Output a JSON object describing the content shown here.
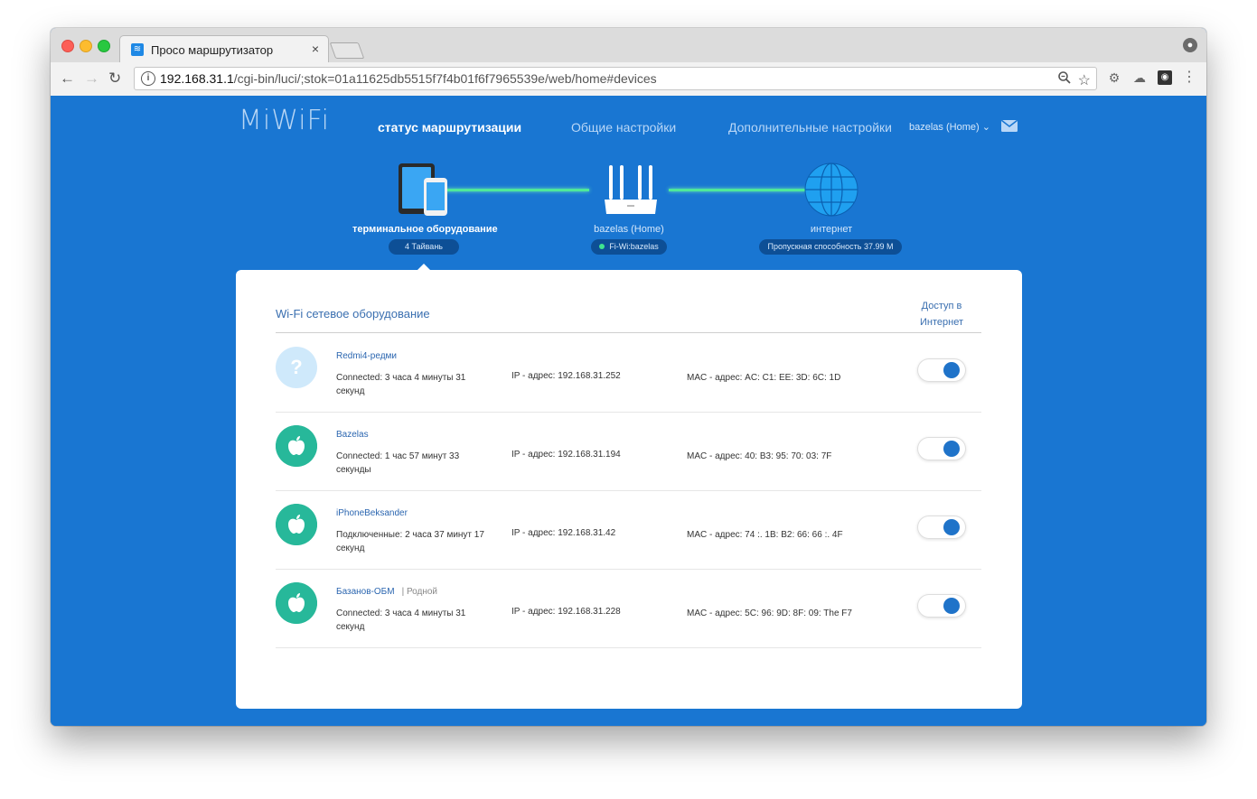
{
  "browser": {
    "tab_title": "Просо маршрутизатор",
    "tab_close": "×",
    "url_host": "192.168.31.1",
    "url_path": "/cgi-bin/luci/;stok=01a11625db5515f7f4b01f6f7965539e/web/home#devices"
  },
  "header": {
    "logo": "MiWiFi",
    "nav": [
      {
        "label": "статус маршрутизации",
        "active": true
      },
      {
        "label": "Общие настройки",
        "active": false
      },
      {
        "label": "Дополнительные настройки",
        "active": false
      }
    ],
    "user": "bazelas (Home)"
  },
  "topology": {
    "devices_label": "терминальное оборудование",
    "devices_pill": "4 Тайвань",
    "router_label": "bazelas (Home)",
    "router_pill": "Fi-Wi:bazelas",
    "internet_label": "интернет",
    "internet_pill": "Пропускная способность 37.99 M"
  },
  "panel": {
    "title": "Wi-Fi сетевое оборудование",
    "access_header": "Доступ в Интернет",
    "devices": [
      {
        "icon": "unknown-device-icon",
        "name": "Redmi4-редми",
        "tag": "",
        "connected": "Connected: 3 часа 4 минуты 31 секунд",
        "ip": "IP - адрес: 192.168.31.252",
        "mac": "MAC - адрес: AC: C1: EE: 3D: 6C: 1D",
        "access": true
      },
      {
        "icon": "apple-icon",
        "name": "Bazelas",
        "tag": "",
        "connected": "Connected: 1 час 57 минут 33 секунды",
        "ip": "IP - адрес: 192.168.31.194",
        "mac": "MAC - адрес: 40: B3: 95: 70: 03: 7F",
        "access": true
      },
      {
        "icon": "apple-icon",
        "name": "iPhoneBeksander",
        "tag": "",
        "connected": "Подключенные: 2 часа 37 минут 17 секунд",
        "ip": "IP - адрес: 192.168.31.42",
        "mac": "MAC - адрес: 74 :. 1B: B2: 66: 66 :. 4F",
        "access": true
      },
      {
        "icon": "apple-icon",
        "name": "Базанов-ОБМ",
        "tag": "| Родной",
        "connected": "Connected: 3 часа 4 минуты 31 секунд",
        "ip": "IP - адрес: 192.168.31.228",
        "mac": "MAC - адрес: 5C: 96: 9D: 8F: 09: The F7",
        "access": true
      }
    ]
  },
  "colors": {
    "background": "#1976d2",
    "link_line": "#4ee89a",
    "apple_avatar": "#27b89a",
    "toggle_on": "#1f73c9"
  }
}
